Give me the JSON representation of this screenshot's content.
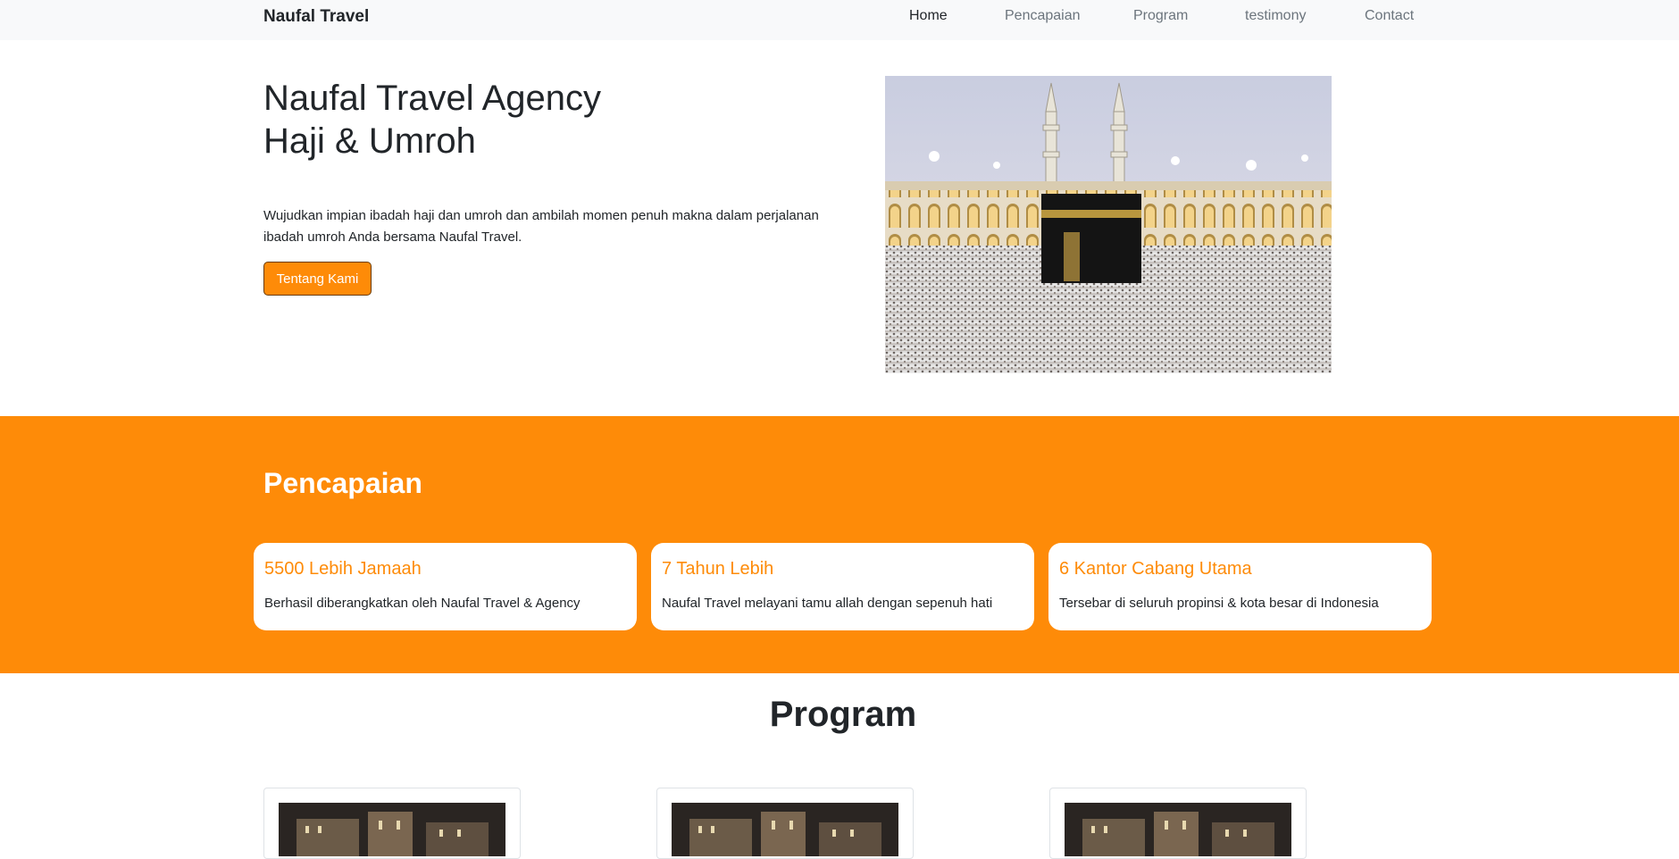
{
  "navbar": {
    "brand": "Naufal Travel",
    "links": [
      "Home",
      "Pencapaian",
      "Program",
      "testimony",
      "Contact"
    ],
    "active": "Home"
  },
  "hero": {
    "title_line1": "Naufal Travel Agency",
    "title_line2": "Haji & Umroh",
    "description": "Wujudkan impian ibadah haji dan umroh dan ambilah momen penuh makna dalam perjalanan ibadah umroh Anda bersama Naufal Travel.",
    "button_label": "Tentang Kami",
    "image_icon": "kaaba-mecca-photo"
  },
  "achievements": {
    "title": "Pencapaian",
    "items": [
      {
        "title": "5500 Lebih Jamaah",
        "text": "Berhasil diberangkatkan oleh Naufal Travel & Agency"
      },
      {
        "title": "7 Tahun Lebih",
        "text": "Naufal Travel melayani tamu allah dengan sepenuh hati"
      },
      {
        "title": "6 Kantor Cabang Utama",
        "text": "Tersebar di seluruh propinsi & kota besar di Indonesia"
      }
    ]
  },
  "program": {
    "title": "Program",
    "card_image_icon": "clock-tower-mecca-photo"
  },
  "colors": {
    "accent": "#fe8b08",
    "navbar_bg": "#f8f9fa",
    "text": "#212529",
    "muted": "#6c757d"
  }
}
